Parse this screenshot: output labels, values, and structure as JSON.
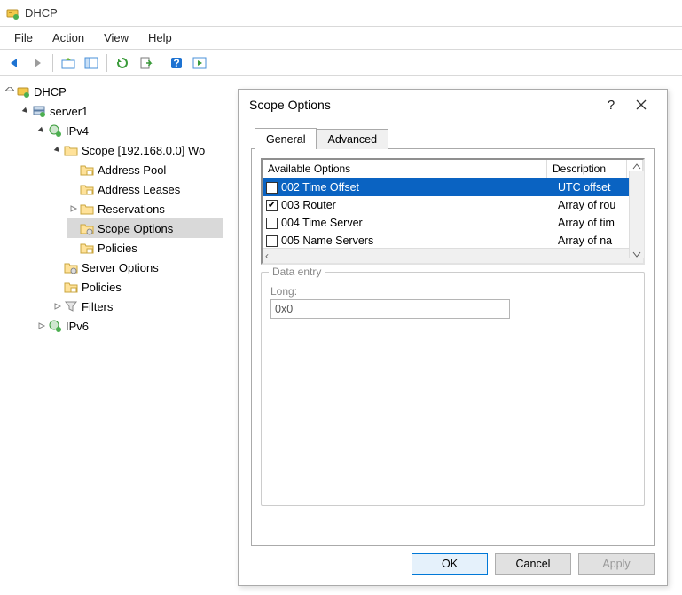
{
  "window": {
    "title": "DHCP"
  },
  "menubar": [
    "File",
    "Action",
    "View",
    "Help"
  ],
  "tree": {
    "root": "DHCP",
    "server": "server1",
    "ipv4": "IPv4",
    "scope": "Scope [192.168.0.0] Wo",
    "scope_children": [
      "Address Pool",
      "Address Leases",
      "Reservations",
      "Scope Options",
      "Policies"
    ],
    "server_children": [
      "Server Options",
      "Policies",
      "Filters"
    ],
    "ipv6": "IPv6"
  },
  "dialog": {
    "title": "Scope Options",
    "tabs": [
      "General",
      "Advanced"
    ],
    "grid": {
      "headers": [
        "Available Options",
        "Description"
      ],
      "rows": [
        {
          "code": "002",
          "name": "002 Time Offset",
          "desc": "UTC offset",
          "checked": false
        },
        {
          "code": "003",
          "name": "003 Router",
          "desc": "Array of rou",
          "checked": true
        },
        {
          "code": "004",
          "name": "004 Time Server",
          "desc": "Array of tim",
          "checked": false
        },
        {
          "code": "005",
          "name": "005 Name Servers",
          "desc": "Array of na",
          "checked": false
        }
      ]
    },
    "data_entry": {
      "legend": "Data entry",
      "label": "Long:",
      "value": "0x0"
    },
    "buttons": {
      "ok": "OK",
      "cancel": "Cancel",
      "apply": "Apply"
    }
  }
}
